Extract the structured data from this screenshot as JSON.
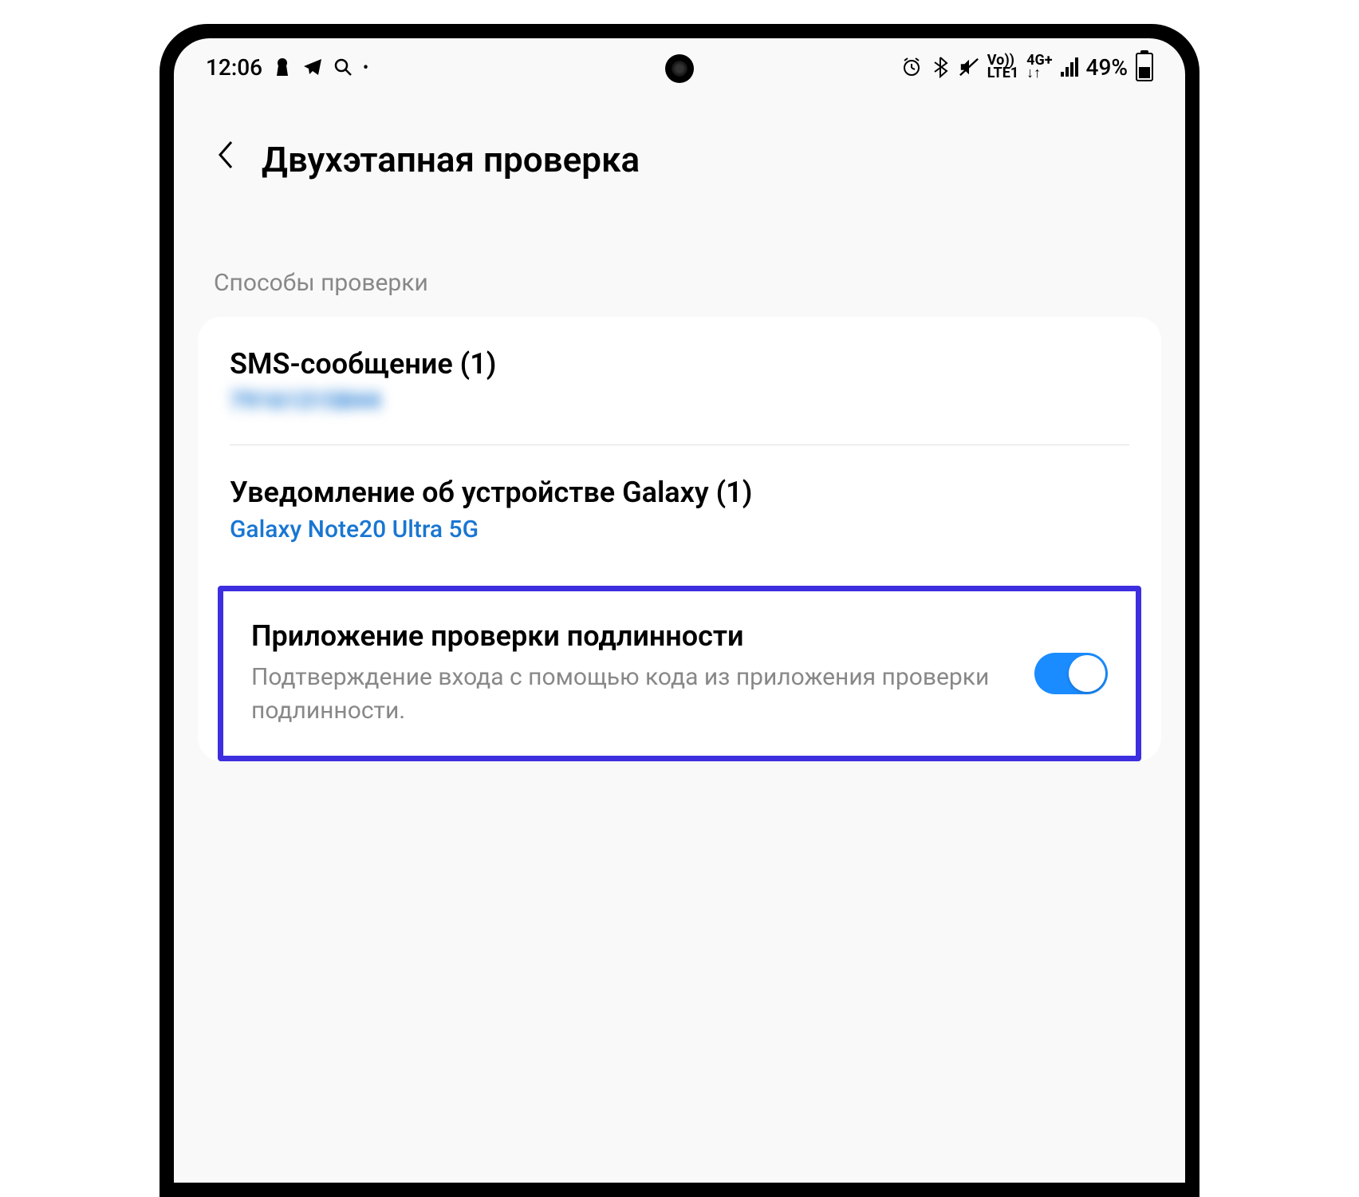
{
  "status_bar": {
    "time": "12:06",
    "battery_percent": "49%",
    "network_label": "Vo))\nLTE1",
    "network_type": "4G+"
  },
  "header": {
    "title": "Двухэтапная проверка"
  },
  "section": {
    "header": "Способы проверки"
  },
  "items": {
    "sms": {
      "title": "SMS-сообщение (1)",
      "value": "79161315844"
    },
    "galaxy": {
      "title": "Уведомление об устройстве Galaxy (1)",
      "value": "Galaxy Note20 Ultra 5G"
    },
    "authenticator": {
      "title": "Приложение проверки подлинности",
      "description": "Подтверждение входа с помощью кода из приложения проверки подлинности.",
      "enabled": true
    }
  }
}
